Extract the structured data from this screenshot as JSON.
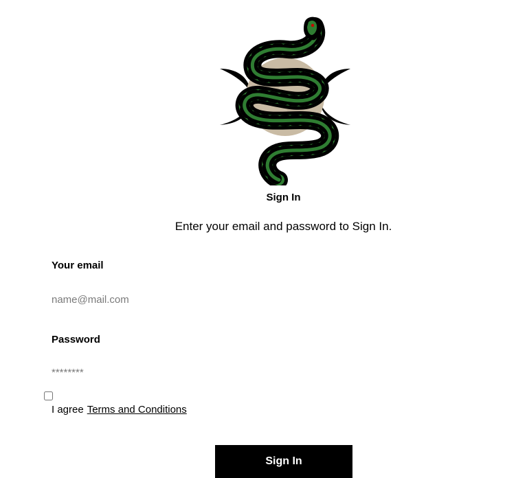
{
  "logo": {
    "icon": "snake-moon-logo",
    "colors": {
      "snake_green": "#2f7d32",
      "snake_black": "#000000",
      "moon": "#c9bba4",
      "eye": "#cc0000"
    }
  },
  "header": {
    "title": "Sign In",
    "subtitle": "Enter your email and password to Sign In."
  },
  "form": {
    "email_label": "Your email",
    "email_placeholder": "name@mail.com",
    "email_value": "",
    "password_label": "Password",
    "password_placeholder": "********",
    "password_value": "",
    "agree_text": "I agree",
    "terms_link": "Terms and Conditions",
    "agree_checked": false,
    "submit_label": "Sign In"
  }
}
